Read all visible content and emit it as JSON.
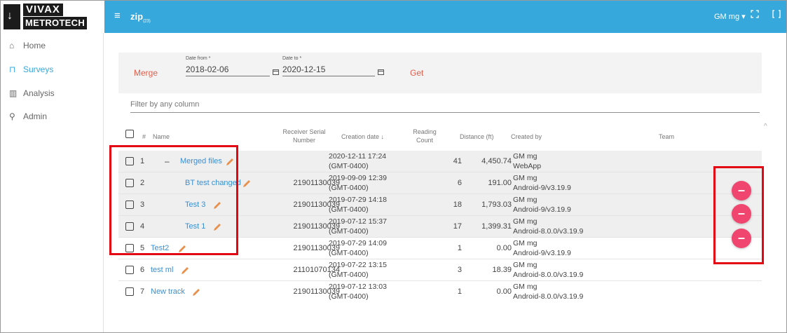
{
  "header": {
    "logo_line1": "VIVAX",
    "logo_line2": "METROTECH",
    "menu_glyph": "≡",
    "app_title": "zip",
    "app_title_sub": "(23)",
    "user_label": "GM mg ▾",
    "accent_color": "#37a8dc",
    "icons": [
      "hamburger-icon",
      "fullscreen-icon",
      "panel-icon"
    ]
  },
  "sidebar": {
    "items": [
      {
        "label": "Home",
        "icon": "⌂"
      },
      {
        "label": "Surveys",
        "icon": "⊓"
      },
      {
        "label": "Analysis",
        "icon": "▥"
      },
      {
        "label": "Admin",
        "icon": "⚲"
      }
    ]
  },
  "filter": {
    "merge_label": "Merge",
    "date_from_label": "Date from *",
    "date_from_value": "2018-02-06",
    "date_to_label": "Date to *",
    "date_to_value": "2020-12-15",
    "get_label": "Get",
    "filter_placeholder": "Filter by any column"
  },
  "table": {
    "headers": {
      "index": "#",
      "name": "Name",
      "serial_line1": "Receiver Serial",
      "serial_line2": "Number",
      "creation": "Creation date ↓",
      "reading_line1": "Reading",
      "reading_line2": "Count",
      "distance": "Distance (ft)",
      "created_by": "Created by",
      "team": "Team"
    },
    "rows": [
      {
        "num": "1",
        "collapse": "–",
        "name": "Merged files",
        "serial": "",
        "date": "2020-12-11 17:24",
        "tz": "(GMT-0400)",
        "count": "41",
        "distance": "4,450.74",
        "user": "GM mg",
        "client": "WebApp"
      },
      {
        "num": "2",
        "name": "BT test changed",
        "serial": "21901130039",
        "date": "2019-09-09 12:39",
        "tz": "(GMT-0400)",
        "count": "6",
        "distance": "191.00",
        "user": "GM mg",
        "client": "Android-9/v3.19.9"
      },
      {
        "num": "3",
        "name": "Test 3",
        "serial": "21901130039",
        "date": "2019-07-29 14:18",
        "tz": "(GMT-0400)",
        "count": "18",
        "distance": "1,793.03",
        "user": "GM mg",
        "client": "Android-9/v3.19.9"
      },
      {
        "num": "4",
        "name": "Test 1",
        "serial": "21901130039",
        "date": "2019-07-12 15:37",
        "tz": "(GMT-0400)",
        "count": "17",
        "distance": "1,399.31",
        "user": "GM mg",
        "client": "Android-8.0.0/v3.19.9"
      },
      {
        "num": "5",
        "name": "Test2",
        "serial": "21901130039",
        "date": "2019-07-29 14:09",
        "tz": "(GMT-0400)",
        "count": "1",
        "distance": "0.00",
        "user": "GM mg",
        "client": "Android-9/v3.19.9"
      },
      {
        "num": "6",
        "name": "test ml",
        "serial": "21101070134",
        "date": "2019-07-22 13:15",
        "tz": "(GMT-0400)",
        "count": "3",
        "distance": "18.39",
        "user": "GM mg",
        "client": "Android-8.0.0/v3.19.9"
      },
      {
        "num": "7",
        "name": "New track",
        "serial": "21901130039",
        "date": "2019-07-12 13:03",
        "tz": "(GMT-0400)",
        "count": "1",
        "distance": "0.00",
        "user": "GM mg",
        "client": "Android-8.0.0/v3.19.9"
      }
    ],
    "remove_glyph": "–",
    "remove_color": "#f0456e",
    "highlight_color": "#e30613"
  }
}
